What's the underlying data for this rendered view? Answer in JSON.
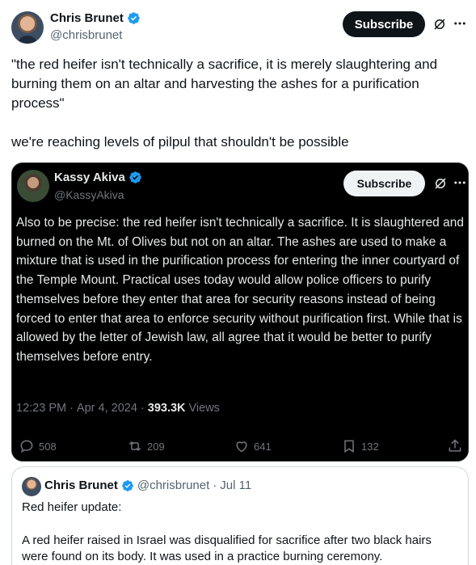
{
  "author": {
    "name": "Chris Brunet",
    "handle": "@chrisbrunet"
  },
  "header": {
    "subscribe_label": "Subscribe",
    "grok_icon": "grok-icon",
    "more_icon": "more-icon"
  },
  "tweet": {
    "text_quote": "\"the red heifer isn't technically a sacrifice, it is merely slaughtering and burning them on an altar and harvesting the ashes for a purification process\"",
    "text_comment": "we're reaching levels of pilpul that shouldn't be possible"
  },
  "embedded_screenshot": {
    "author_name": "Kassy Akiva",
    "author_handle": "@KassyAkiva",
    "subscribe_label": "Subscribe",
    "text": "Also to be precise: the red heifer isn't technically a sacrifice. It is slaughtered and burned on the Mt. of Olives but not on an altar. The ashes are used to make a mixture that is used in the purification process for entering the inner courtyard of the Temple Mount. Practical uses today would allow police officers to purify themselves before they enter that area for security reasons instead of being forced to enter that area to enforce security without purification first. While that is allowed by the letter of Jewish law, all agree that it would be better to purify themselves before entry.",
    "time": "12:23 PM",
    "date": "Apr 4, 2024",
    "views_count": "393.3K",
    "views_label": "Views",
    "replies": "508",
    "reposts": "209",
    "likes": "641",
    "bookmarks": "132",
    "colors": {
      "background": "#000000",
      "text": "#e7e9ea",
      "muted": "#71767b"
    }
  },
  "quoted_tweet": {
    "author_name": "Chris Brunet",
    "author_handle": "@chrisbrunet",
    "separator": "·",
    "date": "Jul 11",
    "line1": "Red heifer update:",
    "line2": "A red heifer raised in Israel was disqualified for sacrifice after two black hairs were found on its body. It was used in a practice burning ceremony."
  },
  "colors": {
    "verified_blue": "#1d9bf0",
    "text_primary": "#0f1419",
    "text_secondary": "#536471",
    "border": "#cfd9de"
  }
}
